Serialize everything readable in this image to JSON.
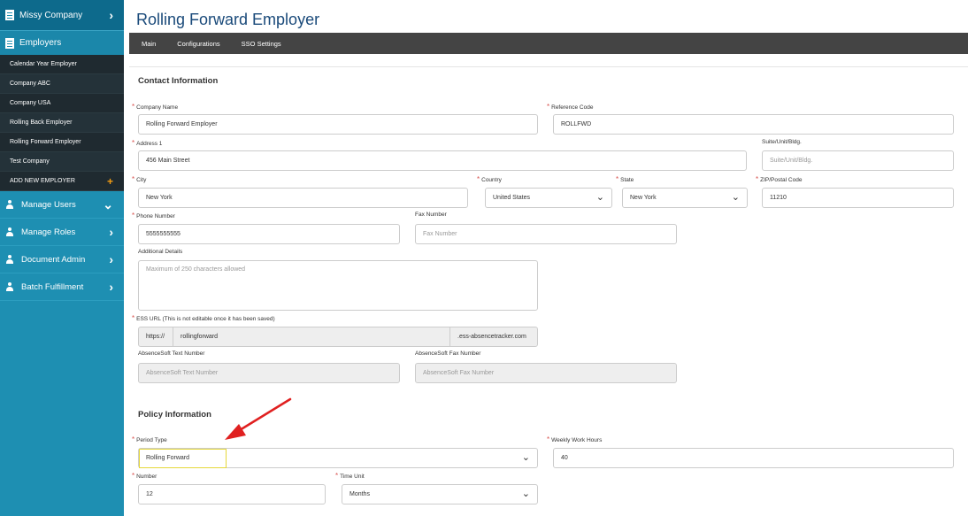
{
  "sidebar": {
    "company": "Missy Company",
    "employers_label": "Employers",
    "employers": [
      "Calendar Year Employer",
      "Company ABC",
      "Company USA",
      "Rolling Back Employer",
      "Rolling Forward Employer",
      "Test Company",
      "ADD NEW EMPLOYER"
    ],
    "menu": [
      "Manage Users",
      "Manage Roles",
      "Document Admin",
      "Batch Fulfillment"
    ]
  },
  "page": {
    "title": "Rolling Forward Employer",
    "tabs": [
      "Main",
      "Configurations",
      "SSO Settings"
    ]
  },
  "contact": {
    "heading": "Contact Information",
    "company_name_label": "Company Name",
    "company_name": "Rolling Forward Employer",
    "reference_code_label": "Reference Code",
    "reference_code": "ROLLFWD",
    "address1_label": "Address 1",
    "address1": "456 Main Street",
    "suite_label": "Suite/Unit/Bldg.",
    "suite_placeholder": "Suite/Unit/Bldg.",
    "city_label": "City",
    "city": "New York",
    "country_label": "Country",
    "country": "United States",
    "state_label": "State",
    "state": "New York",
    "zip_label": "ZIP/Postal Code",
    "zip": "11210",
    "phone_label": "Phone Number",
    "phone": "5555555555",
    "fax_label": "Fax Number",
    "fax_placeholder": "Fax Number",
    "details_label": "Additional Details",
    "details_placeholder": "Maximum of 250 characters allowed",
    "ess_label": "ESS URL (This is not editable once it has been saved)",
    "ess_prefix": "https://",
    "ess_value": "rollingforward",
    "ess_suffix": ".ess-absencetracker.com",
    "as_text_label": "AbsenceSoft Text Number",
    "as_text_placeholder": "AbsenceSoft Text Number",
    "as_fax_label": "AbsenceSoft Fax Number",
    "as_fax_placeholder": "AbsenceSoft Fax Number"
  },
  "policy": {
    "heading": "Policy Information",
    "period_type_label": "Period Type",
    "period_type": "Rolling Forward",
    "weekly_hours_label": "Weekly Work Hours",
    "weekly_hours": "40",
    "number_label": "Number",
    "number": "12",
    "time_unit_label": "Time Unit",
    "time_unit": "Months"
  },
  "colors": {
    "sidebar": "#1e8fb2",
    "title": "#1a4a7a",
    "required": "#d9534f",
    "annotation_arrow": "#e02020",
    "highlight": "#e5d83a"
  }
}
